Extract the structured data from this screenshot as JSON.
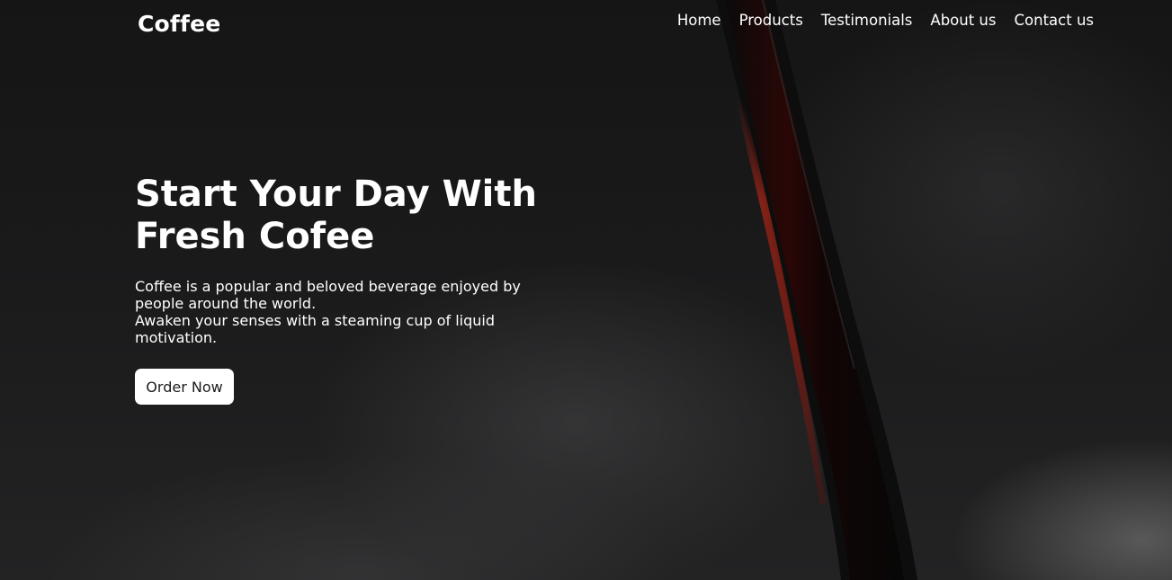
{
  "brand": {
    "name": "Coffee"
  },
  "nav": {
    "items": [
      {
        "label": "Home"
      },
      {
        "label": "Products"
      },
      {
        "label": "Testimonials"
      },
      {
        "label": "About us"
      },
      {
        "label": "Contact us"
      }
    ]
  },
  "hero": {
    "headline_line1": "Start Your Day With",
    "headline_line2": "Fresh Cofee",
    "desc_line1": "Coffee is a popular and beloved beverage enjoyed by people around the world.",
    "desc_line2": "Awaken your senses with a steaming cup of liquid motivation.",
    "cta_label": "Order Now"
  },
  "colors": {
    "background": "#151515",
    "text": "#ffffff",
    "button_bg": "#ffffff",
    "button_text": "#1b1b1b",
    "coffee_stream": "#3a0b08"
  }
}
